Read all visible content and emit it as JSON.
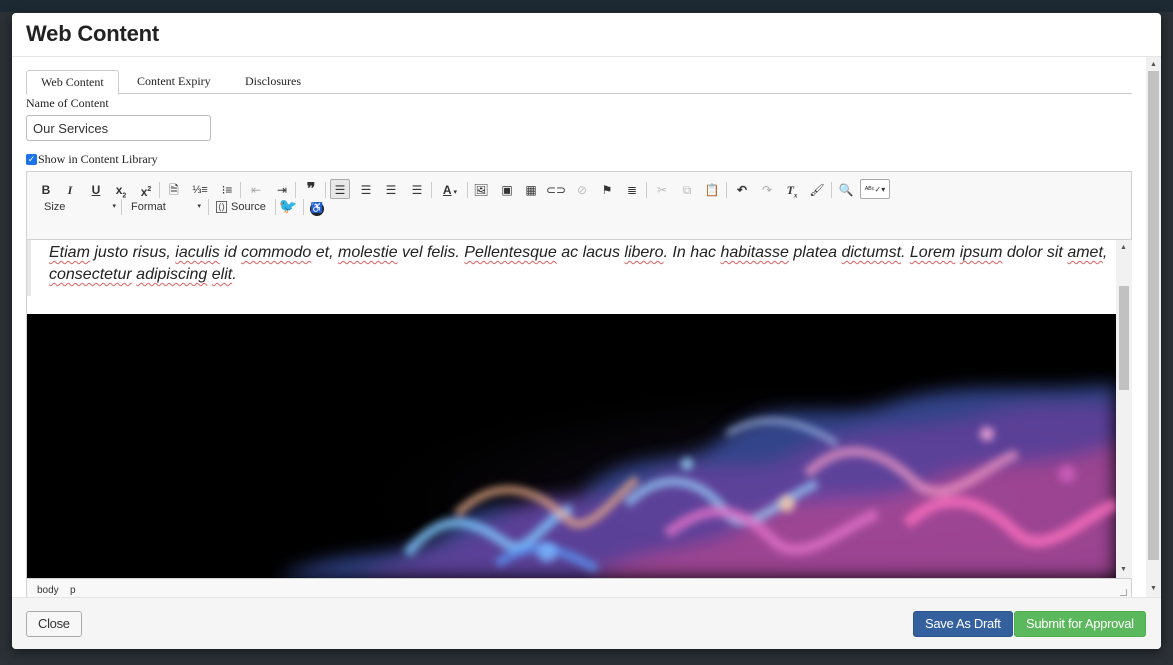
{
  "modal": {
    "title": "Web Content"
  },
  "tabs": [
    {
      "label": "Web Content",
      "active": true
    },
    {
      "label": "Content Expiry",
      "active": false
    },
    {
      "label": "Disclosures",
      "active": false
    }
  ],
  "form": {
    "name_label": "Name of Content",
    "name_value": "Our Services",
    "show_in_library_label": "Show in Content Library",
    "show_in_library_checked": true
  },
  "toolbar": {
    "bold": "B",
    "italic": "I",
    "underline": "U",
    "size_label": "Size",
    "format_label": "Format",
    "source_label": "Source"
  },
  "editor": {
    "paragraph_words": [
      {
        "t": "Etiam",
        "sp": true
      },
      {
        "t": " justo risus, "
      },
      {
        "t": "iaculis",
        "sp": true
      },
      {
        "t": " id "
      },
      {
        "t": "commodo",
        "sp": true
      },
      {
        "t": " et, "
      },
      {
        "t": "molestie",
        "sp": true
      },
      {
        "t": " vel felis. "
      },
      {
        "t": "Pellentesque",
        "sp": true
      },
      {
        "t": " ac lacus "
      },
      {
        "t": "libero",
        "sp": true
      },
      {
        "t": ". In hac "
      },
      {
        "t": "habitasse",
        "sp": true
      },
      {
        "t": " platea "
      },
      {
        "t": "dictumst",
        "sp": true
      },
      {
        "t": ". "
      },
      {
        "t": "Lorem",
        "sp": true
      },
      {
        "t": " "
      },
      {
        "t": "ipsum",
        "sp": true
      },
      {
        "t": " dolor sit "
      },
      {
        "t": "amet",
        "sp": true
      },
      {
        "t": ", "
      },
      {
        "t": "consectetur",
        "sp": true
      },
      {
        "t": " "
      },
      {
        "t": "adipiscing",
        "sp": true
      },
      {
        "t": " "
      },
      {
        "t": "elit",
        "sp": true
      },
      {
        "t": "."
      }
    ],
    "path": [
      "body",
      "p"
    ]
  },
  "footer": {
    "close_label": "Close",
    "draft_label": "Save As Draft",
    "submit_label": "Submit for Approval"
  },
  "colors": {
    "primary": "#34609e",
    "success": "#5cb85c",
    "twitter": "#1da1f2"
  }
}
